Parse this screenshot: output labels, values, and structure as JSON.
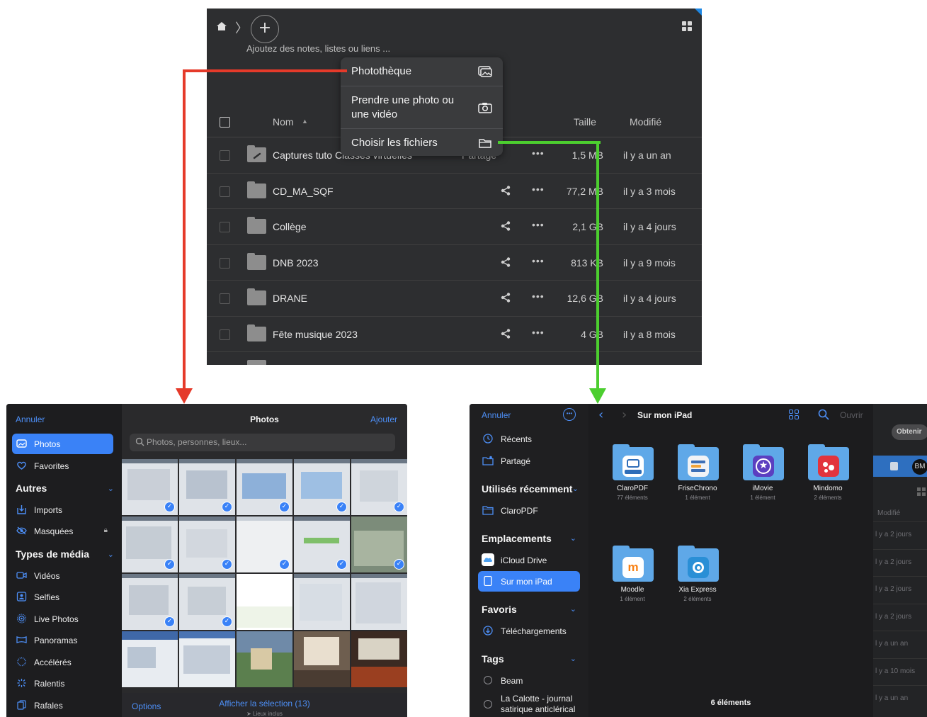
{
  "top": {
    "notes_placeholder": "Ajoutez des notes, listes ou liens ...",
    "columns": {
      "name": "Nom",
      "sort": "▲",
      "size": "Taille",
      "modified": "Modifié"
    },
    "menu": [
      {
        "label": "Photothèque",
        "icon": "photo-library-icon"
      },
      {
        "label": "Prendre une photo ou une vidéo",
        "icon": "camera-icon"
      },
      {
        "label": "Choisir les fichiers",
        "icon": "folder-icon"
      }
    ],
    "rows": [
      {
        "name": "Captures tuto Classes virtuelles",
        "share": "Partagé",
        "size": "1,5 MB",
        "modified": "il y a un an"
      },
      {
        "name": "CD_MA_SQF",
        "size": "77,2 MB",
        "modified": "il y a 3 mois"
      },
      {
        "name": "Collège",
        "size": "2,1 GB",
        "modified": "il y a 4 jours"
      },
      {
        "name": "DNB 2023",
        "size": "813 KB",
        "modified": "il y a 9 mois"
      },
      {
        "name": "DRANE",
        "size": "12,6 GB",
        "modified": "il y a 4 jours"
      },
      {
        "name": "Fête musique 2023",
        "size": "4 GB",
        "modified": "il y a 8 mois"
      }
    ],
    "colors": {
      "left_arrow": "#e53a2a",
      "right_arrow": "#4cce2f"
    }
  },
  "photos": {
    "cancel": "Annuler",
    "title": "Photos",
    "add": "Ajouter",
    "search_placeholder": "Photos, personnes, lieux...",
    "items": {
      "photos": "Photos",
      "favorites": "Favorites",
      "imports": "Imports",
      "hidden": "Masquées",
      "videos": "Vidéos",
      "selfies": "Selfies",
      "live": "Live Photos",
      "panoramas": "Panoramas",
      "timelapse": "Accélérés",
      "slomo": "Ralentis",
      "bursts": "Rafales"
    },
    "sections": {
      "others": "Autres",
      "media_types": "Types de média"
    },
    "options": "Options",
    "show_selection": "Afficher la sélection (13)",
    "places": "➤ Lieux inclus"
  },
  "files": {
    "cancel": "Annuler",
    "recents": "Récents",
    "shared": "Partagé",
    "recently_used": "Utilisés récemment",
    "claropdf_fav": "ClaroPDF",
    "locations": "Emplacements",
    "icloud": "iCloud Drive",
    "on_ipad": "Sur mon iPad",
    "favorites": "Favoris",
    "downloads": "Téléchargements",
    "tags": "Tags",
    "tag1": "Beam",
    "tag2a": "La Calotte - journal",
    "tag2b": "satirique anticlérical",
    "title": "Sur mon iPad",
    "open": "Ouvrir",
    "apps": [
      {
        "name": "ClaroPDF",
        "count": "77 éléments",
        "icon": "claropdf-icon"
      },
      {
        "name": "FriseChrono",
        "count": "1 élément",
        "icon": "frisechrono-icon"
      },
      {
        "name": "iMovie",
        "count": "1 élément",
        "icon": "imovie-icon"
      },
      {
        "name": "Mindomo",
        "count": "2 éléments",
        "icon": "mindomo-icon"
      },
      {
        "name": "Moodle",
        "count": "1 élément",
        "icon": "moodle-icon"
      },
      {
        "name": "Xia Express",
        "count": "2 éléments",
        "icon": "xia-icon"
      }
    ],
    "footer_count": "6 éléments",
    "right": {
      "get": "Obtenir",
      "avatar": "BM",
      "modified": "Modifié",
      "rows": [
        "l y a 2 jours",
        "l y a 2 jours",
        "l y a 2 jours",
        "l y a 2 jours",
        "l y a un an",
        "l y a 10 mois",
        "l y a un an"
      ]
    }
  }
}
